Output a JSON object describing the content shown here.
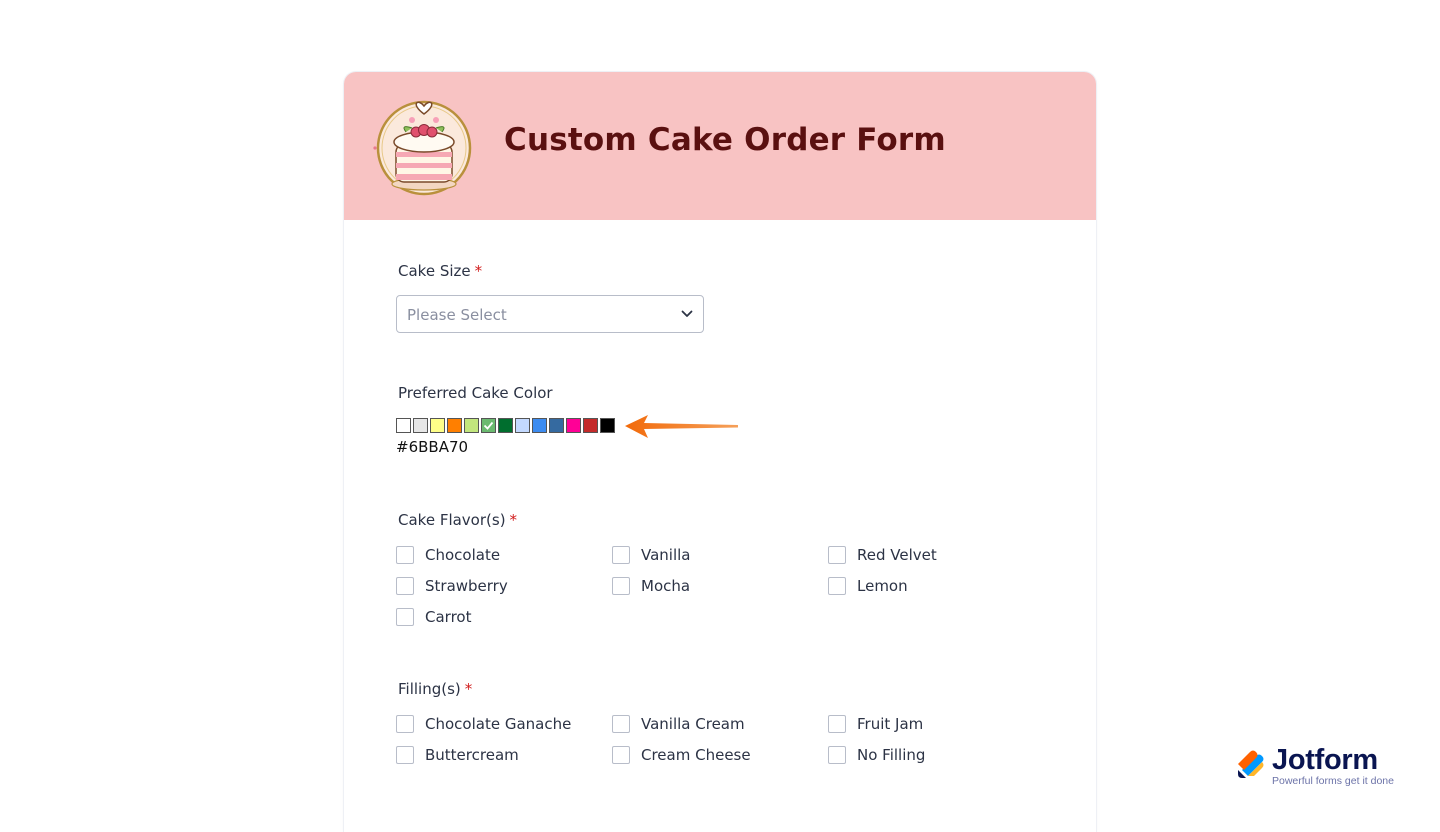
{
  "form": {
    "title": "Custom Cake Order Form",
    "header_color": "#f8c3c3"
  },
  "cake_size": {
    "label": "Cake Size",
    "required_mark": "*",
    "placeholder": "Please Select"
  },
  "cake_color": {
    "label": "Preferred Cake Color",
    "swatches": [
      "#ffffff",
      "#e6e6e6",
      "#ffff88",
      "#ff7f00",
      "#c2e67d",
      "#6bba70",
      "#006e2e",
      "#c3d9ff",
      "#3d8cf0",
      "#356aa0",
      "#ff0096",
      "#c42b2b",
      "#000000"
    ],
    "selected": "#6BBA70",
    "value_text": "#6BBA70"
  },
  "flavors": {
    "label": "Cake Flavor(s)",
    "required_mark": "*",
    "options": [
      "Chocolate",
      "Vanilla",
      "Red Velvet",
      "Strawberry",
      "Mocha",
      "Lemon",
      "Carrot"
    ]
  },
  "fillings": {
    "label": "Filling(s)",
    "required_mark": "*",
    "options": [
      "Chocolate Ganache",
      "Vanilla Cream",
      "Fruit Jam",
      "Buttercream",
      "Cream Cheese",
      "No Filling"
    ]
  },
  "branding": {
    "name": "Jotform",
    "tagline": "Powerful forms get it done"
  },
  "annotation": {
    "arrow_color": "#f07a1a"
  }
}
